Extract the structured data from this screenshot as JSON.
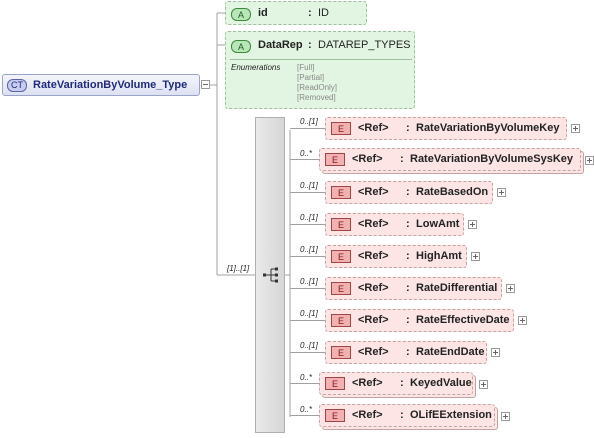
{
  "complex_type": {
    "badge": "CT",
    "name": "RateVariationByVolume_Type"
  },
  "attributes": [
    {
      "badge": "A",
      "name": "id",
      "separator": ":",
      "type": "ID"
    },
    {
      "badge": "A",
      "name": "DataRep",
      "separator": ":",
      "type": "DATAREP_TYPES",
      "enumerations_label": "Enumerations",
      "enumerations": [
        "[Full]",
        "[Partial]",
        "[ReadOnly]",
        "[Removed]"
      ]
    }
  ],
  "sequence": {
    "occurrence": "[1]..[1]",
    "icon": "sequence-icon"
  },
  "elements": [
    {
      "badge": "E",
      "occurrence": "0..[1]",
      "ref": "<Ref>",
      "separator": ":",
      "name": "RateVariationByVolumeKey"
    },
    {
      "badge": "E",
      "occurrence": "0..*",
      "ref": "<Ref>",
      "separator": ":",
      "name": "RateVariationByVolumeSysKey"
    },
    {
      "badge": "E",
      "occurrence": "0..[1]",
      "ref": "<Ref>",
      "separator": ":",
      "name": "RateBasedOn"
    },
    {
      "badge": "E",
      "occurrence": "0..[1]",
      "ref": "<Ref>",
      "separator": ":",
      "name": "LowAmt"
    },
    {
      "badge": "E",
      "occurrence": "0..[1]",
      "ref": "<Ref>",
      "separator": ":",
      "name": "HighAmt"
    },
    {
      "badge": "E",
      "occurrence": "0..[1]",
      "ref": "<Ref>",
      "separator": ":",
      "name": "RateDifferential"
    },
    {
      "badge": "E",
      "occurrence": "0..[1]",
      "ref": "<Ref>",
      "separator": ":",
      "name": "RateEffectiveDate"
    },
    {
      "badge": "E",
      "occurrence": "0..[1]",
      "ref": "<Ref>",
      "separator": ":",
      "name": "RateEndDate"
    },
    {
      "badge": "E",
      "occurrence": "0..*",
      "ref": "<Ref>",
      "separator": ":",
      "name": "KeyedValue"
    },
    {
      "badge": "E",
      "occurrence": "0..*",
      "ref": "<Ref>",
      "separator": ":",
      "name": "OLifEExtension"
    }
  ]
}
